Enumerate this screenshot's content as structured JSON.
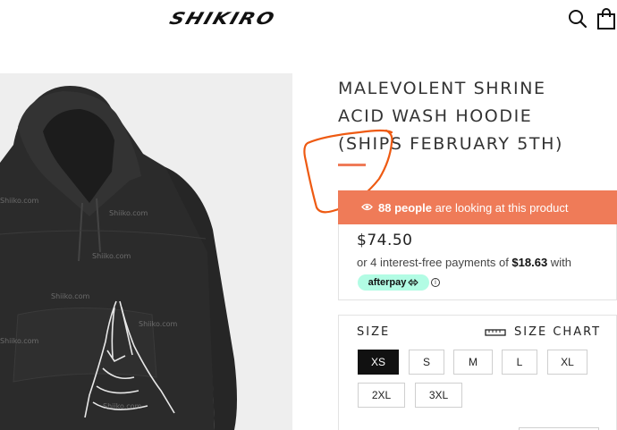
{
  "header": {
    "logo_text": "SHIKIRO",
    "search_icon": "search-icon",
    "cart_icon": "shopping-bag-icon"
  },
  "product_image": {
    "watermark": "Shiiko.com"
  },
  "product": {
    "title_lines": [
      "MALEVOLENT SHRINE",
      "ACID WASH HOODIE",
      "(SHIPS FEBRUARY 5TH)"
    ],
    "viewers": {
      "icon": "eye-icon",
      "count_text": "88 people",
      "suffix": " are looking at this product"
    },
    "price": "$74.50",
    "installments": {
      "prefix": "or 4 interest-free payments of ",
      "amount": "$18.63",
      "suffix": " with"
    },
    "afterpay": {
      "label": "afterpay",
      "info_icon": "info-icon",
      "info_glyph": "i"
    }
  },
  "size": {
    "label": "SIZE",
    "chart_label": "SIZE CHART",
    "chart_icon": "ruler-icon",
    "options": [
      "XS",
      "S",
      "M",
      "L",
      "XL",
      "2XL",
      "3XL"
    ],
    "selected": "XS"
  },
  "colors": {
    "accent": "#ef7b58",
    "afterpay": "#b2fce4",
    "annotation": "#ee5a12"
  }
}
